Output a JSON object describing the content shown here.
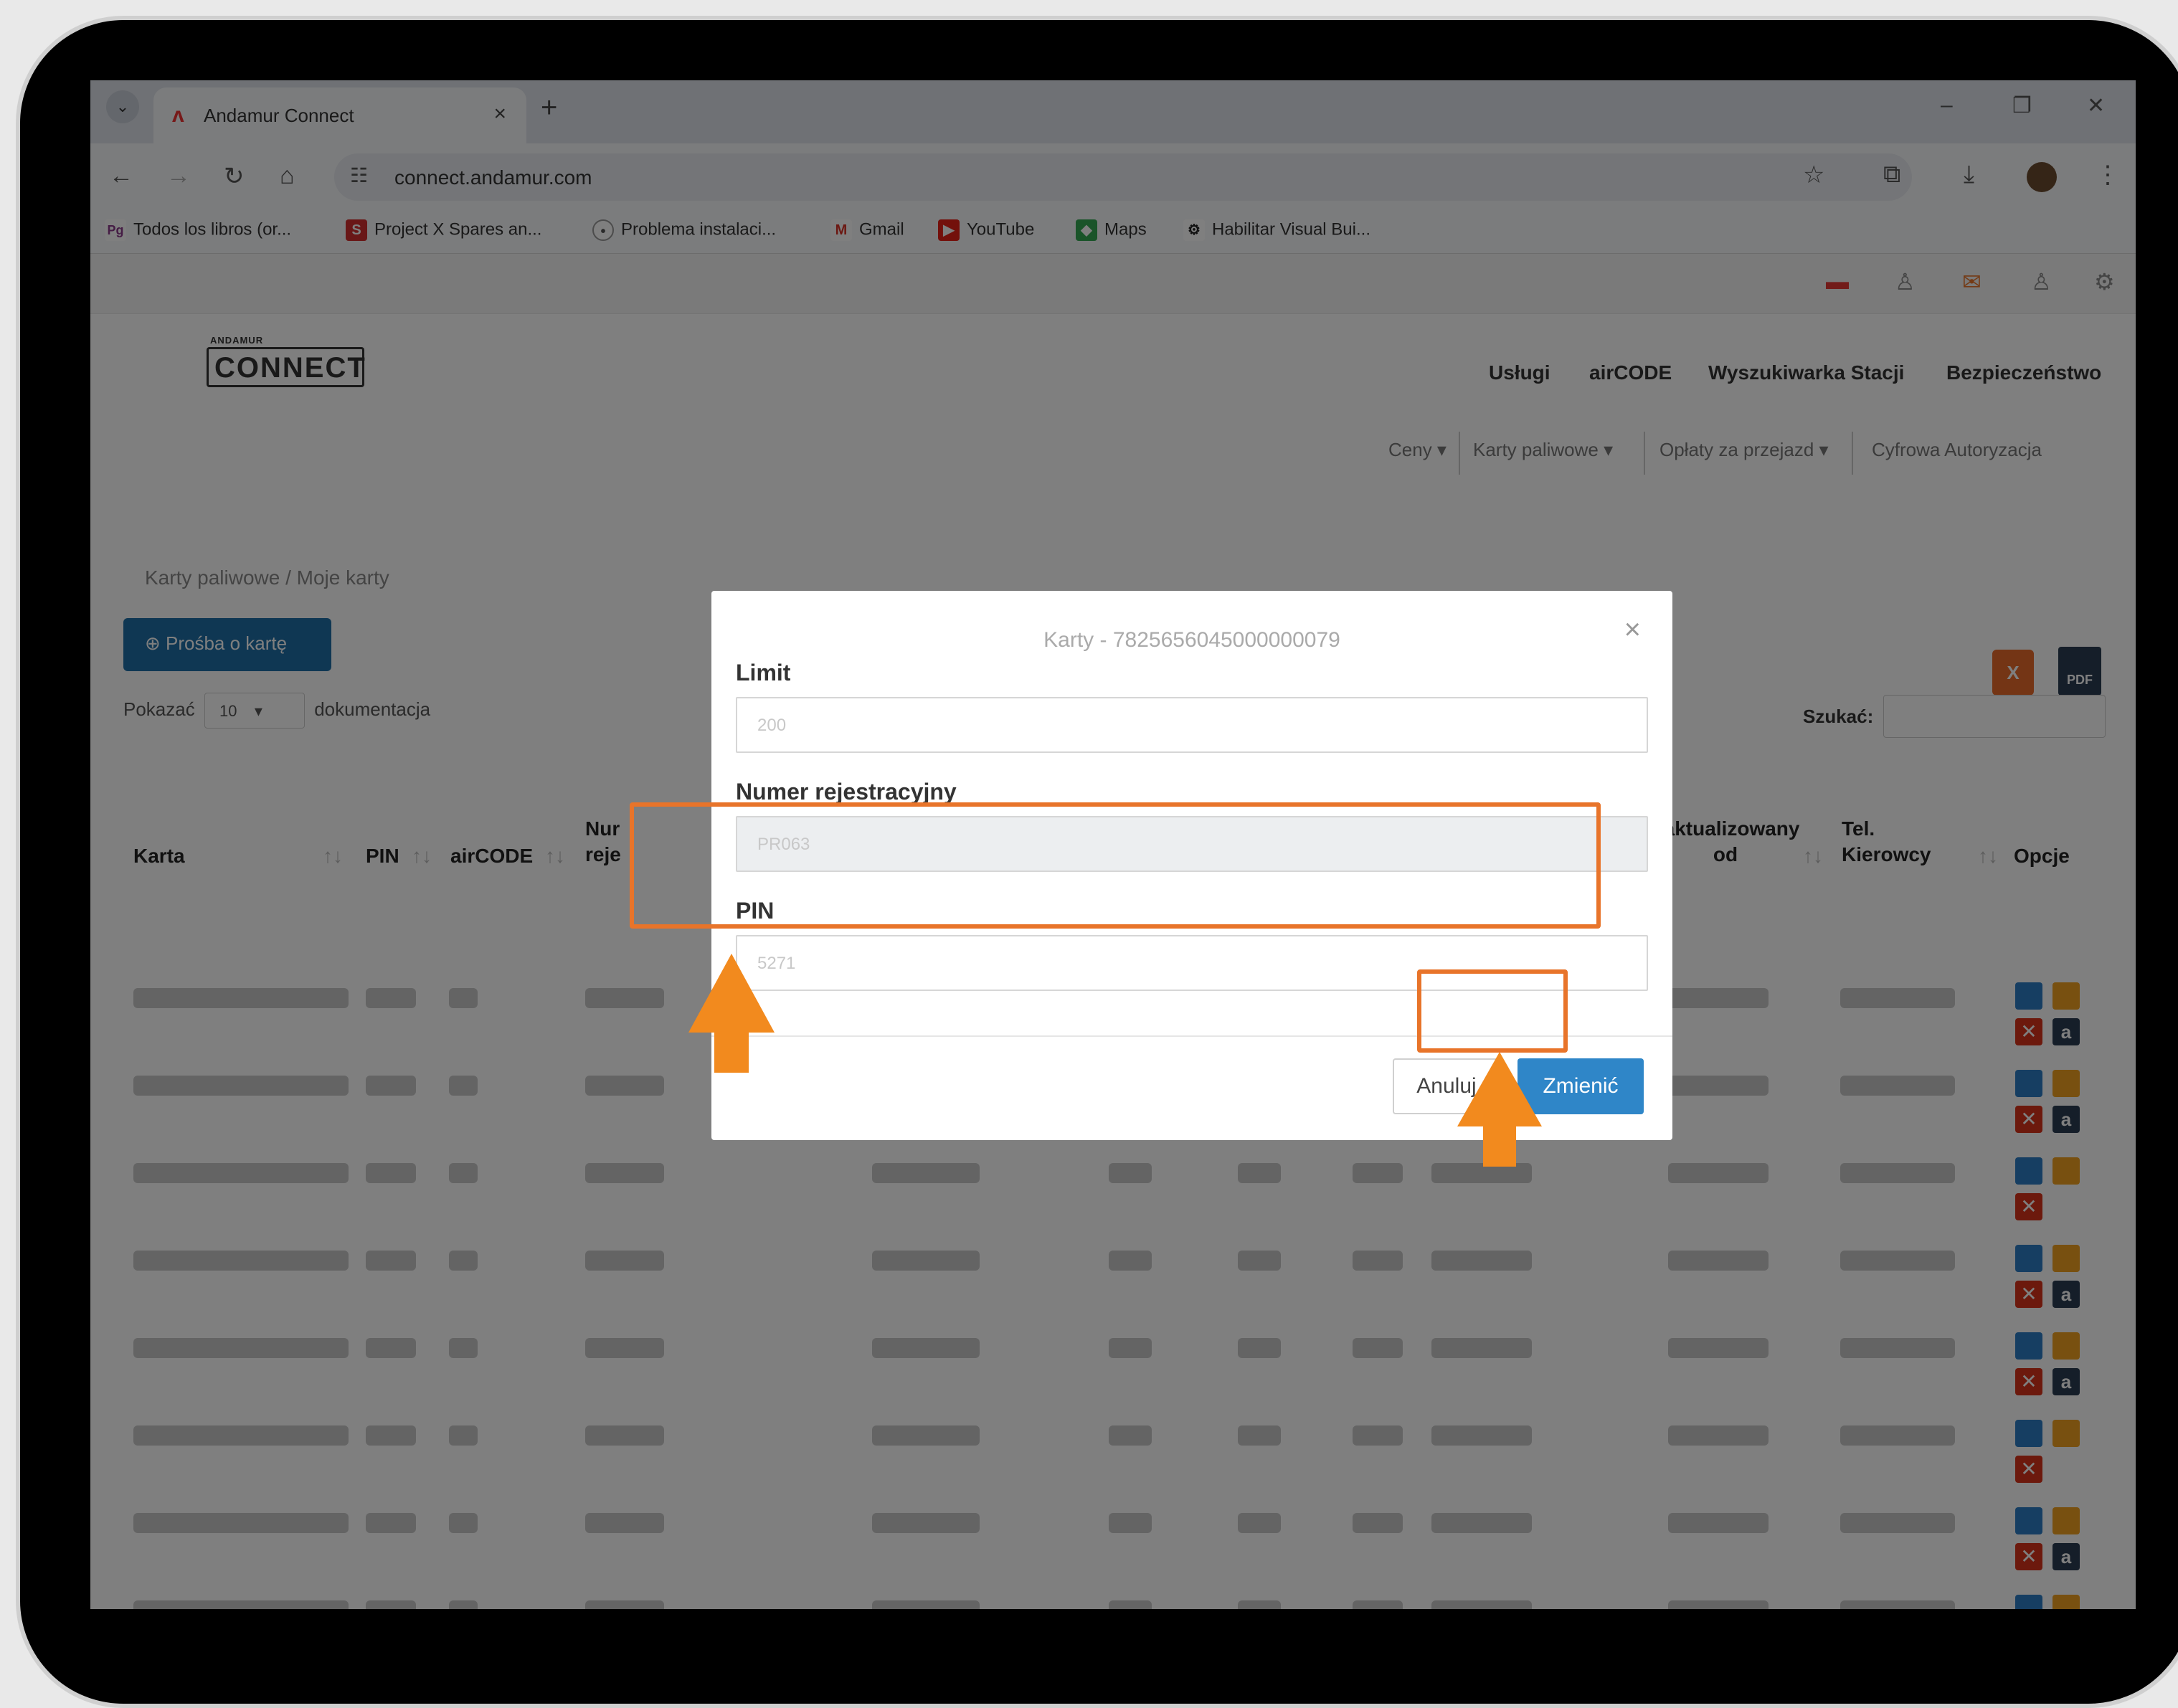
{
  "browser": {
    "tab_title": "Andamur Connect",
    "url": "connect.andamur.com",
    "bookmarks": [
      "Todos los libros (or...",
      "Project X Spares an...",
      "Problema instalaci...",
      "Gmail",
      "YouTube",
      "Maps",
      "Habilitar Visual Bui..."
    ]
  },
  "site": {
    "logo_small": "ANDAMUR",
    "logo_big": "CONNECT",
    "nav": [
      "Usługi",
      "airCODE",
      "Wyszukiwarka Stacji",
      "Bezpieczeństwo"
    ],
    "subnav": [
      "Ceny ▾",
      "Karty paliwowe ▾",
      "Opłaty za przejazd ▾",
      "Cyfrowa Autoryzacja"
    ],
    "breadcrumb": "Karty paliwowe  /  Moje karty",
    "request_button": "Prośba o kartę",
    "show_prefix": "Pokazać",
    "show_value": "10",
    "show_suffix": "dokumentacja",
    "search_label": "Szukać:"
  },
  "table": {
    "headers": {
      "card": "Karta",
      "pin": "PIN",
      "aircode": "airCODE",
      "reg_1": "Nur",
      "reg_2": "reje",
      "updated_1": "Zaktualizowany",
      "updated_2": "od",
      "phone_1": "Tel.",
      "phone_2": "Kierowcy",
      "options": "Opcje"
    }
  },
  "modal": {
    "title": "Karty - 7825656045000000079",
    "limit_label": "Limit",
    "limit_value": "200",
    "reg_label": "Numer rejestracyjny",
    "reg_value": "PR063",
    "pin_label": "PIN",
    "pin_value": "5271",
    "cancel_label": "Anuluj",
    "submit_label": "Zmienić"
  },
  "colors": {
    "highlight": "#e8742a",
    "primary_button": "#2f86c8"
  }
}
